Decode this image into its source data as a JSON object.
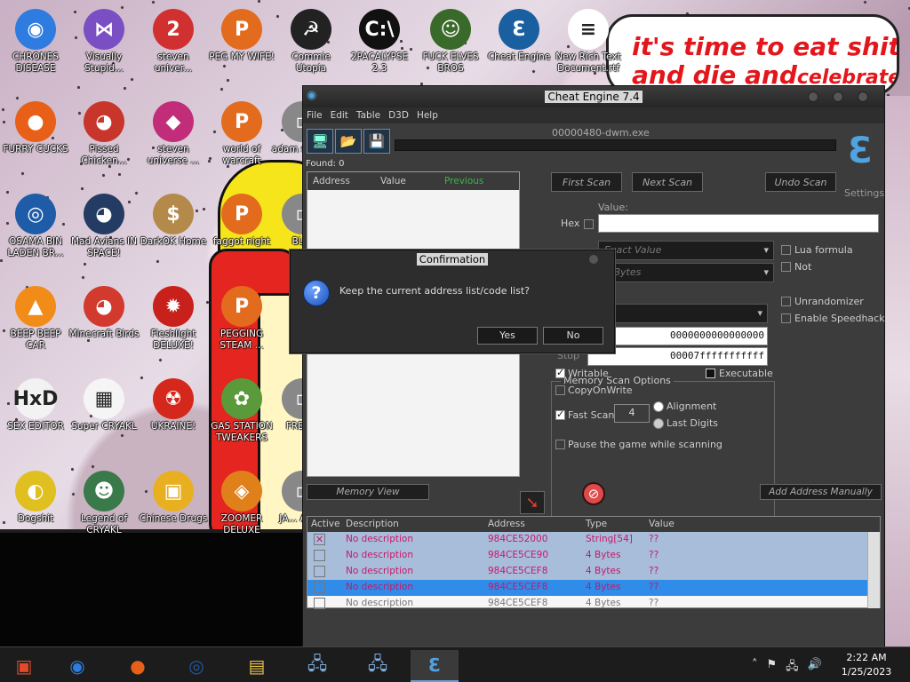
{
  "desktop": {
    "icons": [
      {
        "label": "CHRONES DISEASE",
        "icon": "chrome-icon",
        "color": "#2f7ce0"
      },
      {
        "label": "Visually Stupid...",
        "icon": "visual-studio-icon",
        "color": "#7b4fc4"
      },
      {
        "label": "steven univer...",
        "icon": "pokeball-icon",
        "color": "#d03030"
      },
      {
        "label": "PEG MY WIFE!",
        "icon": "pegasus-icon",
        "color": "#e36b1e"
      },
      {
        "label": "Commie Utopia",
        "icon": "sickle-icon",
        "color": "#222222"
      },
      {
        "label": "2PACALYPSE 2.3",
        "icon": "cmd-icon",
        "color": "#111111"
      },
      {
        "label": "FUCK ELVES BROS",
        "icon": "elf-icon",
        "color": "#3a6a2a"
      },
      {
        "label": "Cheat Engine",
        "icon": "cheat-engine-icon",
        "color": "#1a5fa0"
      },
      {
        "label": "New Rich Text Document.rtf",
        "icon": "document-icon",
        "color": "#ffffff"
      },
      {
        "label": "FURRY CUCKS",
        "icon": "firefox-icon",
        "color": "#e85f17"
      },
      {
        "label": "Pissed Chicken...",
        "icon": "angry-birds-seasons-icon",
        "color": "#c8352a"
      },
      {
        "label": "steven universe ...",
        "icon": "gem-icon",
        "color": "#c22d7a"
      },
      {
        "label": "world of warcraft",
        "icon": "pegasus-icon",
        "color": "#e36b1e"
      },
      {
        "label": "OSAMA BIN LADEN BR...",
        "icon": "obama-logo-icon",
        "color": "#1f5ca8"
      },
      {
        "label": "Mad Avians IN SPACE!",
        "icon": "angry-birds-space-icon",
        "color": "#243b63"
      },
      {
        "label": "DarkOK Home",
        "icon": "money-bag-icon",
        "color": "#b48a4a"
      },
      {
        "label": "faggot night",
        "icon": "pegasus-icon",
        "color": "#e36b1e"
      },
      {
        "label": "BEEP BEEP CAR",
        "icon": "vlc-cone-icon",
        "color": "#f28c18"
      },
      {
        "label": "Minecraft Birds",
        "icon": "angry-birds-icon",
        "color": "#d23a2e"
      },
      {
        "label": "Fleshlight DELUXE!",
        "icon": "red-creature-icon",
        "color": "#c8201a"
      },
      {
        "label": "PEGGING STEAM ...",
        "icon": "pegasus-icon",
        "color": "#e36b1e"
      },
      {
        "label": "SEX EDITOR",
        "icon": "hxd-icon",
        "color": "#f2f2f2"
      },
      {
        "label": "Super CRYAKL",
        "icon": "pixel-dog-icon",
        "color": "#f5f5f5"
      },
      {
        "label": "UKRAINE!",
        "icon": "radiation-icon",
        "color": "#d4281c"
      },
      {
        "label": "GAS STATION TWEAKERS",
        "icon": "flower-icon",
        "color": "#5a9a3a"
      },
      {
        "label": "Dogshit",
        "icon": "eclipse-icon",
        "color": "#e0c020"
      },
      {
        "label": "Legend of CRYAKL",
        "icon": "pixel-character-icon",
        "color": "#3a7a4a"
      },
      {
        "label": "Chinese Drugs",
        "icon": "mahjong-icon",
        "color": "#e8b020"
      },
      {
        "label": "ZOOMER DELUXE",
        "icon": "zuma-icon",
        "color": "#e0801a"
      },
      {
        "label": "adam simu...",
        "icon": "generic-icon",
        "color": "#888888"
      },
      {
        "label": "BL...",
        "icon": "generic-icon",
        "color": "#888888"
      },
      {
        "label": "FREE...",
        "icon": "generic-icon",
        "color": "#888888"
      },
      {
        "label": "JA... ANI...",
        "icon": "generic-icon",
        "color": "#888888"
      }
    ],
    "speech_bubble": {
      "line1": "it's time to eat shit",
      "line2": "and die and",
      "line2b": "celebrate"
    }
  },
  "cheat_engine": {
    "title": "Cheat Engine 7.4",
    "menu": [
      "File",
      "Edit",
      "Table",
      "D3D",
      "Help"
    ],
    "process": "00000480-dwm.exe",
    "found": "Found: 0",
    "found_columns": [
      "Address",
      "Value",
      "Previous"
    ],
    "buttons": {
      "first_scan": "First Scan",
      "next_scan": "Next Scan",
      "undo_scan": "Undo Scan"
    },
    "settings": "Settings",
    "value_label": "Value:",
    "hex_label": "Hex",
    "scan_type": "Exact Value",
    "value_type": "4 Bytes",
    "memory_scan_options": "Memory Scan Options",
    "lua_formula": "Lua formula",
    "not_label": "Not",
    "unrandomizer": "Unrandomizer",
    "enable_speedhack": "Enable Speedhack",
    "start_value": "0000000000000000",
    "stop_label": "Stop",
    "stop_value": "00007fffffffffff",
    "writable": "Writable",
    "executable": "Executable",
    "copy_on_write": "CopyOnWrite",
    "fast_scan": "Fast Scan",
    "fast_scan_value": "4",
    "alignment": "Alignment",
    "last_digits": "Last Digits",
    "pause_game": "Pause the game while scanning",
    "memory_view": "Memory View",
    "add_address_manually": "Add Address Manually",
    "address_columns": [
      "Active",
      "Description",
      "Address",
      "Type",
      "Value"
    ],
    "address_rows": [
      {
        "description": "No description",
        "address": "984CE52000",
        "type": "String[54]",
        "value": "??",
        "state": "selected-checked"
      },
      {
        "description": "No description",
        "address": "984CE5CE90",
        "type": "4 Bytes",
        "value": "??",
        "state": "selected"
      },
      {
        "description": "No description",
        "address": "984CE5CEF8",
        "type": "4 Bytes",
        "value": "??",
        "state": "selected"
      },
      {
        "description": "No description",
        "address": "984CE5CEF8",
        "type": "4 Bytes",
        "value": "??",
        "state": "focused"
      },
      {
        "description": "No description",
        "address": "984CE5CEF8",
        "type": "4 Bytes",
        "value": "??",
        "state": "normal"
      }
    ]
  },
  "dialog": {
    "title": "Confirmation",
    "message": "Keep the current address list/code list?",
    "yes": "Yes",
    "no": "No"
  },
  "taskbar": {
    "apps": [
      "start-icon",
      "chrome-icon",
      "firefox-icon",
      "obama-logo-icon",
      "file-explorer-icon",
      "network-computer-icon",
      "network-computer-icon",
      "cheat-engine-icon"
    ],
    "time": "2:22 AM",
    "date": "1/25/2023"
  }
}
